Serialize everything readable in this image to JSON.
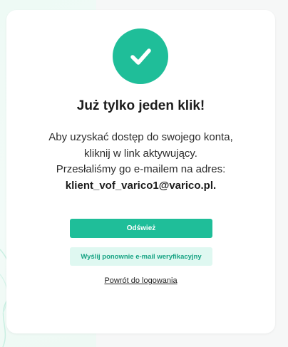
{
  "confirmation": {
    "title": "Już tylko jeden klik!",
    "line1": "Aby uzyskać dostęp do swojego konta,",
    "line2": "kliknij w link aktywujący.",
    "line3": "Przesłaliśmy go e-mailem na adres:",
    "email": "klient_vof_varico1@varico.pl."
  },
  "actions": {
    "refresh_label": "Odśwież",
    "resend_label": "Wyślij ponownie e-mail weryfikacyjny",
    "back_label": "Powrót do logowania"
  },
  "icons": {
    "status": "check-icon"
  },
  "colors": {
    "accent": "#1fbe99",
    "accent_light": "#dff8f1",
    "accent_text": "#16a383"
  }
}
